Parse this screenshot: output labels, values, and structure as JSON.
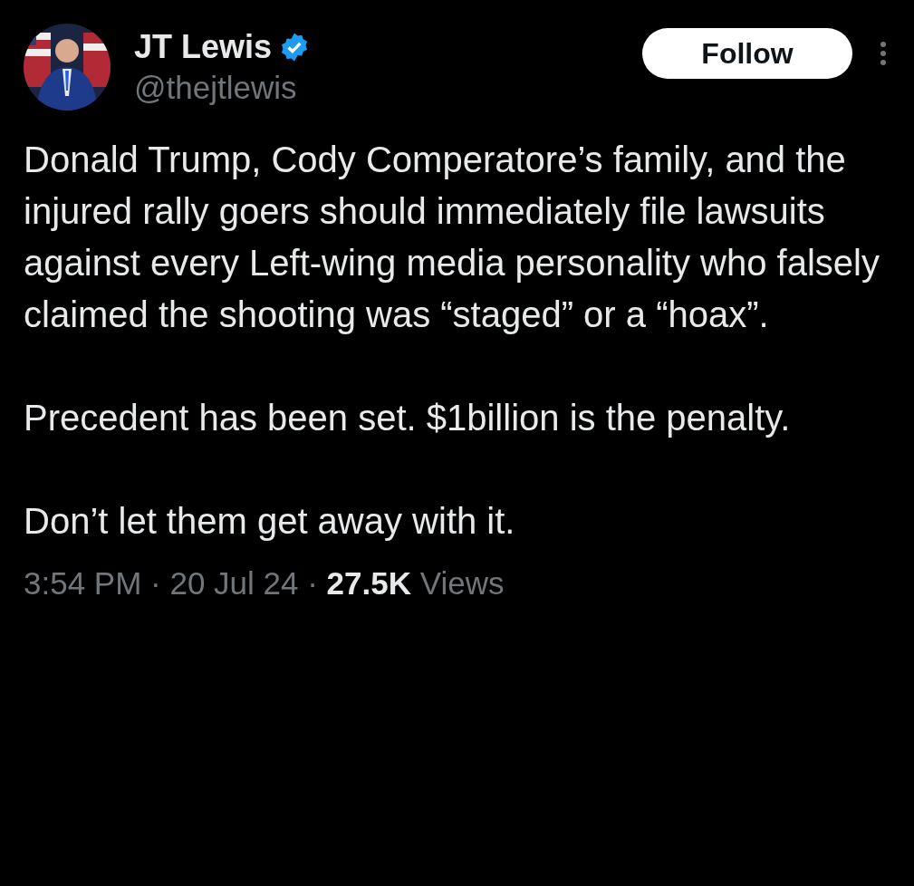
{
  "author": {
    "name": "JT Lewis",
    "verified": true,
    "handle": "@thejtlewis"
  },
  "follow_button": {
    "label": "Follow"
  },
  "body": [
    "Donald Trump, Cody Comperatore’s family, and the injured rally goers should immediately file lawsuits against every Left-wing media personality who falsely claimed the shooting was “staged” or a “hoax”.",
    "Precedent has been set. $1billion is the penalty.",
    "Don’t let them get away with it."
  ],
  "meta": "3:54 PM · 20 Jul 24 · **27.5K** Views"
}
